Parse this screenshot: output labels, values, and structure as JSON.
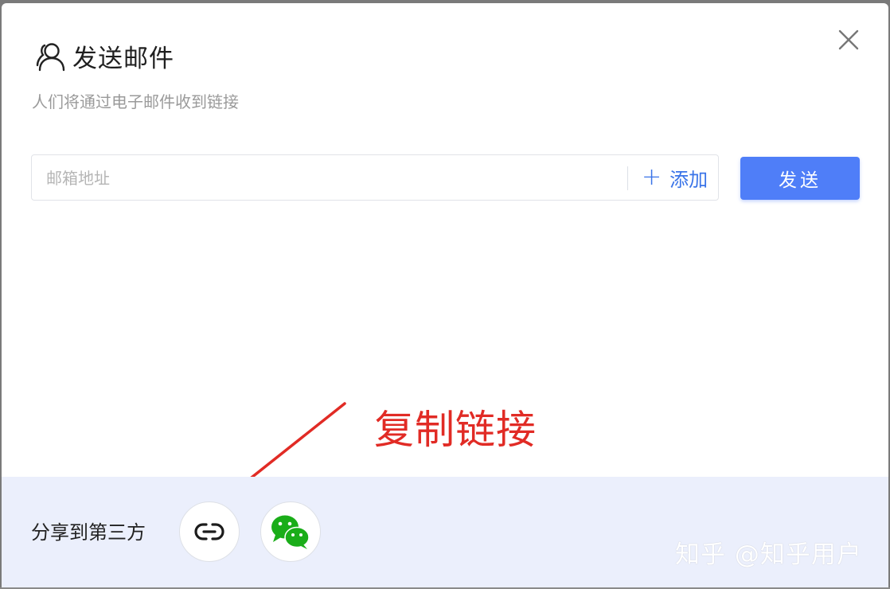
{
  "dialog": {
    "title": "发送邮件",
    "subtitle": "人们将通过电子邮件收到链接",
    "title_icon": "user-group-icon",
    "close_icon": "close-icon"
  },
  "email": {
    "placeholder": "邮箱地址",
    "value": "",
    "add_label": "添加",
    "add_icon": "plus-icon",
    "send_label": "发送"
  },
  "annotation": {
    "text": "复制链接",
    "color": "#e12b25"
  },
  "share": {
    "label": "分享到第三方",
    "options": [
      {
        "name": "copy-link",
        "icon": "link-icon"
      },
      {
        "name": "wechat",
        "icon": "wechat-icon"
      }
    ]
  },
  "watermark": "知乎 @知乎用户",
  "colors": {
    "accent": "#4f7ef8",
    "link": "#3a74e8",
    "footer_bg": "#ebeffc",
    "wechat_green": "#1aad19"
  }
}
